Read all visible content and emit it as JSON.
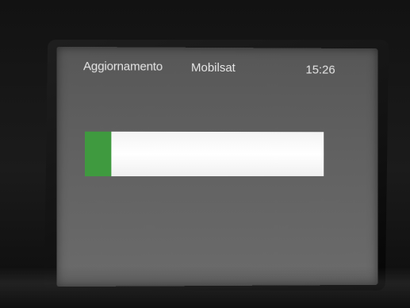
{
  "screen": {
    "title": "Aggiornamento",
    "subtitle": "Mobilsat",
    "clock": "15:26"
  },
  "progress": {
    "fraction": 0.11,
    "fill_color": "#3f9a3f",
    "track_color": "#ffffff"
  }
}
